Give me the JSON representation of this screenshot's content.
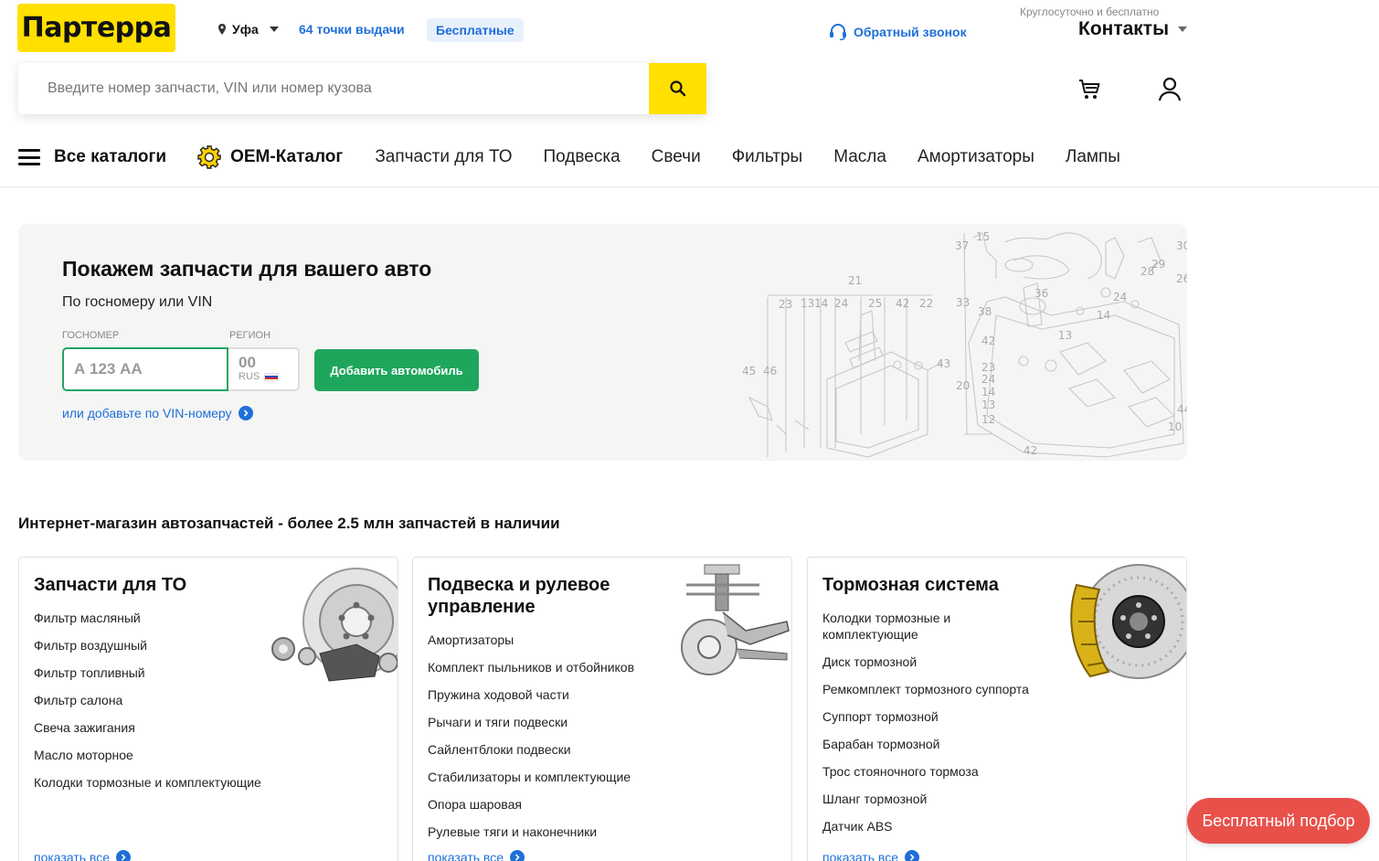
{
  "header": {
    "logo": "Партерра",
    "city": "Уфа",
    "pickup_points": "64 точки выдачи",
    "free_badge": "Бесплатные",
    "callback": "Обратный звонок",
    "allday": "Круглосуточно и бесплатно",
    "contacts": "Контакты",
    "accent_color": "#FFE000",
    "link_color": "#1e6fd9"
  },
  "search": {
    "placeholder": "Введите номер запчасти, VIN или номер кузова",
    "value": ""
  },
  "nav": {
    "all_catalogs": "Все каталоги",
    "oem": "ОЕМ-Каталог",
    "items": [
      "Запчасти для ТО",
      "Подвеска",
      "Свечи",
      "Фильтры",
      "Масла",
      "Амортизаторы",
      "Лампы"
    ]
  },
  "garage": {
    "title": "Покажем запчасти для вашего авто",
    "subtitle": "По госномеру или VIN",
    "plate_label": "ГОСНОМЕР",
    "region_label": "РЕГИОН",
    "plate_placeholder": "А 123 АА",
    "region_placeholder": "00",
    "region_country": "RUS",
    "add_button": "Добавить автомобиль",
    "vin_link": "или добавьте по VIN-номеру",
    "schematic_numbers": [
      "15",
      "37",
      "30",
      "21",
      "29",
      "28",
      "26",
      "23",
      "13",
      "14",
      "24",
      "25",
      "42",
      "22",
      "33",
      "36",
      "38",
      "24",
      "14",
      "13",
      "42",
      "45",
      "46",
      "43",
      "20",
      "23",
      "24",
      "14",
      "13",
      "12",
      "44",
      "10",
      "42"
    ],
    "button_color": "#1fa65d"
  },
  "section": {
    "title": "Интернет-магазин автозапчастей - более 2.5 млн запчастей в наличии",
    "show_all": "показать все"
  },
  "cards": [
    {
      "title": "Запчасти для ТО",
      "items": [
        "Фильтр масляный",
        "Фильтр воздушный",
        "Фильтр топливный",
        "Фильтр салона",
        "Свеча зажигания",
        "Масло моторное",
        "Колодки тормозные и комплектующие"
      ]
    },
    {
      "title": "Подвеска и рулевое управление",
      "items": [
        "Амортизаторы",
        "Комплект пыльников и отбойников",
        "Пружина ходовой части",
        "Рычаги и тяги подвески",
        "Сайлентблоки подвески",
        "Стабилизаторы и комплектующие",
        "Опора шаровая",
        "Рулевые тяги и наконечники"
      ]
    },
    {
      "title": "Тормозная система",
      "items": [
        "Колодки тормозные и комплектующие",
        "Диск тормозной",
        "Ремкомплект тормозного суппорта",
        "Суппорт тормозной",
        "Барабан тормозной",
        "Трос стояночного тормоза",
        "Шланг тормозной",
        "Датчик ABS"
      ]
    }
  ],
  "fab": {
    "label": "Бесплатный подбор",
    "color": "#e8504a"
  }
}
